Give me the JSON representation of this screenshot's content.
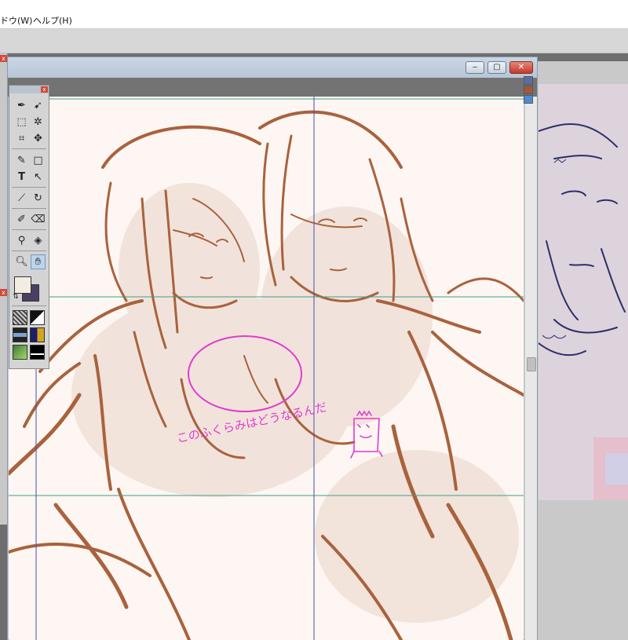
{
  "menubar": {
    "items": [
      "ドウ(W)",
      "ヘルプ(H)"
    ]
  },
  "window": {
    "minimize_label": "‒",
    "maximize_label": "▢",
    "close_label": "✕"
  },
  "palette": {
    "close_label": "x",
    "tools": [
      "pen-tool",
      "direct-select-tool",
      "marquee-tool",
      "magic-wand-tool",
      "crop-tool",
      "move-tool",
      "pen-path-tool",
      "rectangle-tool",
      "type-tool",
      "arrow-select-tool",
      "brush-tool",
      "lasso-tool",
      "airbrush-tool",
      "eraser-tool",
      "eyedropper-tool",
      "fill-tool",
      "zoom-tool",
      "hand-tool"
    ],
    "active_tool": "hand-tool",
    "foreground_color": "#f3ece2",
    "background_color": "#4a3f63"
  },
  "canvas": {
    "paper_color": "#fdf6f2",
    "sketch_color": "#a9623d",
    "annotation_color": "#e23bd0",
    "guide_color": "#3f9c86",
    "guide_v_color": "#4451a6",
    "annotation_text": "このふくらみはどうなるんだ"
  }
}
